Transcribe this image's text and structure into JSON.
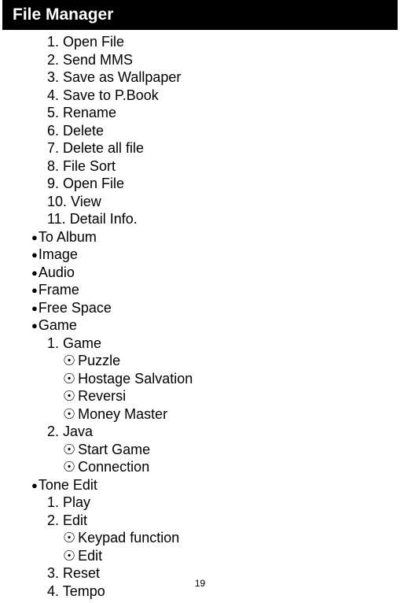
{
  "header": "File Manager",
  "items": {
    "n1": "1. Open File",
    "n2": "2. Send MMS",
    "n3": "3. Save as Wallpaper",
    "n4": "4. Save to P.Book",
    "n5": "5. Rename",
    "n6": "6. Delete",
    "n7": "7. Delete all file",
    "n8": "8. File Sort",
    "n9": "9. Open File",
    "n10": "10. View",
    "n11": "11. Detail Info.",
    "b1": "To Album",
    "b2": "Image",
    "b3": "Audio",
    "b4": "Frame",
    "b5": "Free Space",
    "b6": "Game",
    "gn1": "1. Game",
    "gd1": "Puzzle",
    "gd2": "Hostage Salvation",
    "gd3": "Reversi",
    "gd4": "Money Master",
    "gn2": "2. Java",
    "jd1": "Start Game",
    "jd2": "Connection",
    "b7": "Tone Edit",
    "tn1": "1. Play",
    "tn2": "2. Edit",
    "td1": "Keypad function",
    "td2": "Edit",
    "tn3": "3. Reset",
    "tn4": "4. Tempo"
  },
  "pageNumber": "19"
}
